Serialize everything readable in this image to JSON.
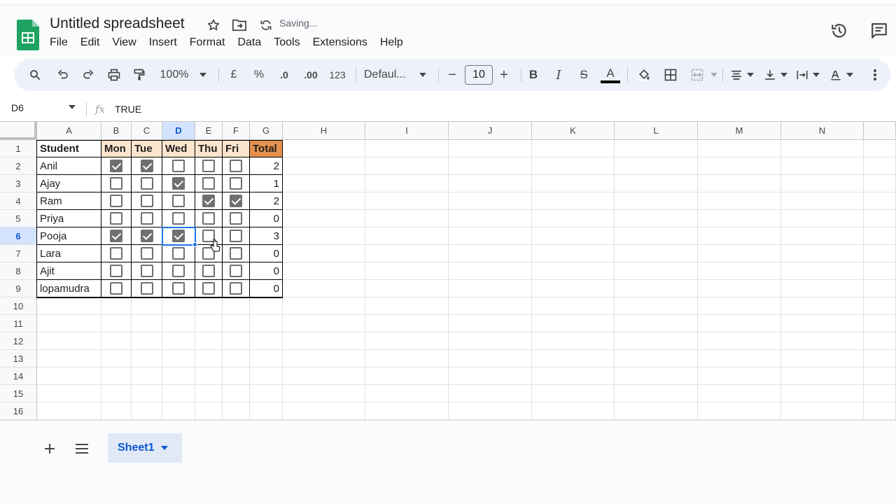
{
  "app": {
    "title": "Untitled spreadsheet",
    "status": "Saving...",
    "icons": [
      "sheets-logo-icon",
      "star-icon",
      "move-folder-icon",
      "sync-icon",
      "version-history-icon",
      "comments-icon"
    ]
  },
  "menu": [
    "File",
    "Edit",
    "View",
    "Insert",
    "Format",
    "Data",
    "Tools",
    "Extensions",
    "Help"
  ],
  "toolbar": {
    "zoom": "100%",
    "currency": "£",
    "percent": "%",
    "dec_decrease": ".0",
    "dec_increase": ".00",
    "number_format": "123",
    "font": "Defaul...",
    "font_size": "10",
    "minus": "−",
    "plus": "+",
    "bold": "B",
    "italic": "I",
    "strike": "S",
    "text_color": "A"
  },
  "formula_bar": {
    "name_box": "D6",
    "fx": "fx",
    "value": "TRUE"
  },
  "columns": [
    "A",
    "B",
    "C",
    "D",
    "E",
    "F",
    "G",
    "H",
    "I",
    "J",
    "K",
    "L",
    "M",
    "N"
  ],
  "rows": [
    "1",
    "2",
    "3",
    "4",
    "5",
    "6",
    "7",
    "8",
    "9",
    "10",
    "11",
    "12",
    "13",
    "14",
    "15",
    "16"
  ],
  "selected": {
    "column": "D",
    "row": "6"
  },
  "table": {
    "headers": [
      "Student",
      "Mon",
      "Tue",
      "Wed",
      "Thu",
      "Fri",
      "Total"
    ],
    "rows": [
      {
        "name": "Anil",
        "days": [
          true,
          true,
          false,
          false,
          false
        ],
        "total": "2"
      },
      {
        "name": "Ajay",
        "days": [
          false,
          false,
          true,
          false,
          false
        ],
        "total": "1"
      },
      {
        "name": "Ram",
        "days": [
          false,
          false,
          false,
          true,
          true
        ],
        "total": "2"
      },
      {
        "name": "Priya",
        "days": [
          false,
          false,
          false,
          false,
          false
        ],
        "total": "0"
      },
      {
        "name": "Pooja",
        "days": [
          true,
          true,
          true,
          false,
          false
        ],
        "total": "3"
      },
      {
        "name": "Lara",
        "days": [
          false,
          false,
          false,
          false,
          false
        ],
        "total": "0"
      },
      {
        "name": "Ajit",
        "days": [
          false,
          false,
          false,
          false,
          false
        ],
        "total": "0"
      },
      {
        "name": "lopamudra",
        "days": [
          false,
          false,
          false,
          false,
          false
        ],
        "total": "0"
      }
    ]
  },
  "sheets": [
    {
      "name": "Sheet1",
      "active": true
    }
  ],
  "colors": {
    "header_fill": "#fce5cd",
    "total_fill": "#e6914d",
    "selection": "#1a73e8",
    "checkbox": "#6f6f6f",
    "accent": "#0b57d0"
  }
}
